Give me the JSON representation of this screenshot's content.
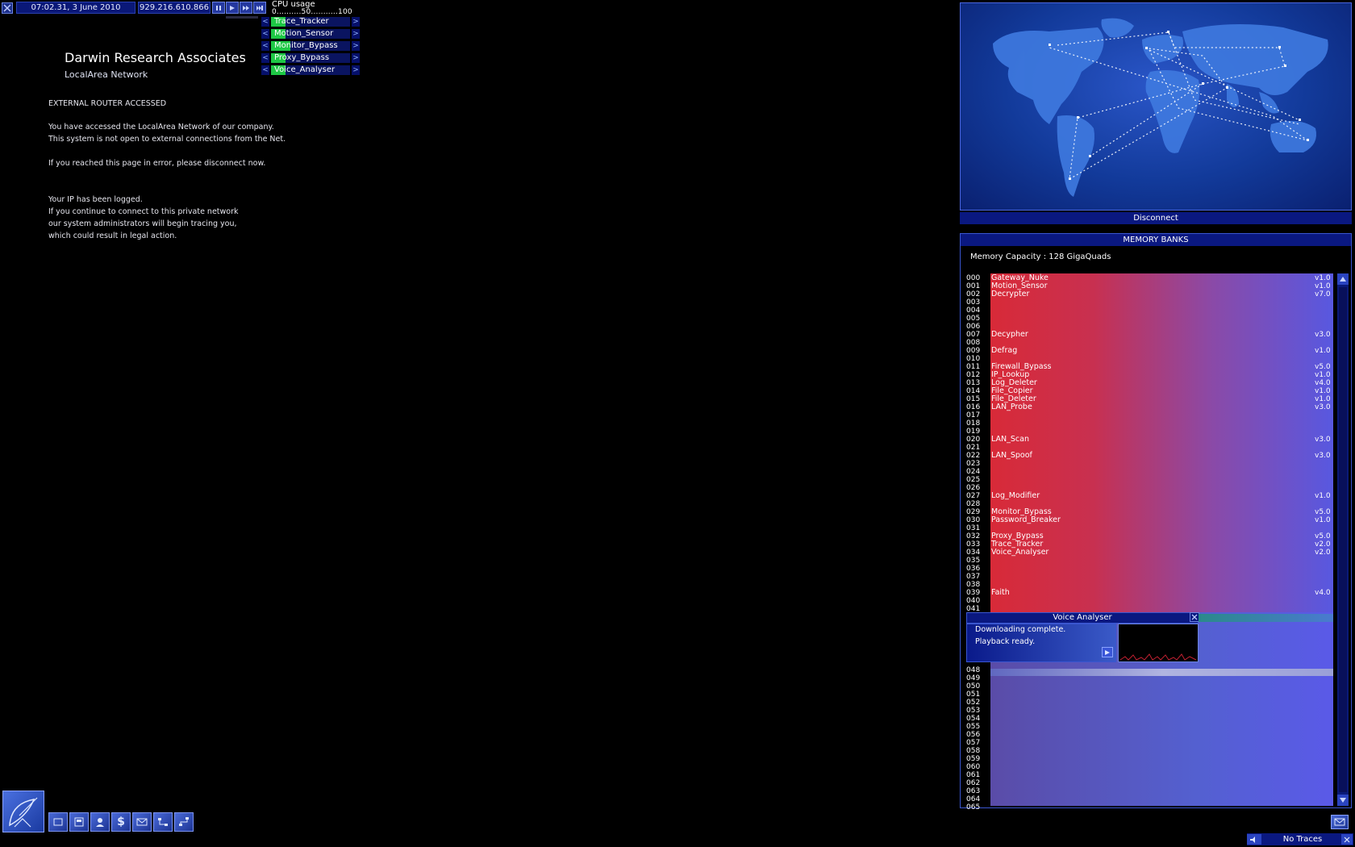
{
  "status": {
    "datetime": "07:02.31, 3 June 2010",
    "ip": "929.216.610.866"
  },
  "cpu": {
    "title": "CPU usage",
    "scale": "0..........50...........100",
    "programs": [
      {
        "name": "Trace_Tracker",
        "usage_fraction": 0.18
      },
      {
        "name": "Motion_Sensor",
        "usage_fraction": 0.18
      },
      {
        "name": "Monitor_Bypass",
        "usage_fraction": 0.24
      },
      {
        "name": "Proxy_Bypass",
        "usage_fraction": 0.18
      },
      {
        "name": "Voice_Analyser",
        "usage_fraction": 0.18
      }
    ],
    "left_arrow": "<",
    "right_arrow": ">"
  },
  "page": {
    "company": "Darwin Research Associates",
    "subtitle": "LocalArea Network",
    "heading": "EXTERNAL ROUTER ACCESSED",
    "lines": [
      "You have accessed the LocalArea Network of our company.",
      "This system is not open to external connections from the Net.",
      "If you reached this page in error, please disconnect now.",
      "Your IP has been logged.",
      "If you continue to connect to this private network",
      "our system administrators will begin tracing you,",
      "which could result in legal action."
    ]
  },
  "map": {
    "disconnect": "Disconnect"
  },
  "memory": {
    "title": "MEMORY BANKS",
    "capacity": "Memory Capacity : 128 GigaQuads",
    "rows_top": [
      "000",
      "001",
      "002",
      "003",
      "004",
      "005",
      "006",
      "007",
      "008",
      "009",
      "010",
      "011",
      "012",
      "013",
      "014",
      "015",
      "016",
      "017",
      "018",
      "019",
      "020",
      "021",
      "022",
      "023",
      "024",
      "025",
      "026",
      "027",
      "028",
      "029",
      "030",
      "031",
      "032",
      "033",
      "034",
      "035",
      "036",
      "037",
      "038",
      "039",
      "040",
      "041"
    ],
    "rows_bottom": [
      "048",
      "049",
      "050",
      "051",
      "052",
      "053",
      "054",
      "055",
      "056",
      "057",
      "058",
      "059",
      "060",
      "061",
      "062",
      "063",
      "064",
      "065"
    ],
    "programs": [
      {
        "slot": 0,
        "name": "Gateway_Nuke",
        "version": "v1.0"
      },
      {
        "slot": 1,
        "name": "Motion_Sensor",
        "version": "v1.0"
      },
      {
        "slot": 2,
        "name": "Decrypter",
        "version": "v7.0"
      },
      {
        "slot": 7,
        "name": "Decypher",
        "version": "v3.0"
      },
      {
        "slot": 9,
        "name": "Defrag",
        "version": "v1.0"
      },
      {
        "slot": 11,
        "name": "Firewall_Bypass",
        "version": "v5.0"
      },
      {
        "slot": 12,
        "name": "IP_Lookup",
        "version": "v1.0"
      },
      {
        "slot": 13,
        "name": "Log_Deleter",
        "version": "v4.0"
      },
      {
        "slot": 14,
        "name": "File_Copier",
        "version": "v1.0"
      },
      {
        "slot": 15,
        "name": "File_Deleter",
        "version": "v1.0"
      },
      {
        "slot": 16,
        "name": "LAN_Probe",
        "version": "v3.0"
      },
      {
        "slot": 20,
        "name": "LAN_Scan",
        "version": "v3.0"
      },
      {
        "slot": 22,
        "name": "LAN_Spoof",
        "version": "v3.0"
      },
      {
        "slot": 27,
        "name": "Log_Modifier",
        "version": "v1.0"
      },
      {
        "slot": 29,
        "name": "Monitor_Bypass",
        "version": "v5.0"
      },
      {
        "slot": 30,
        "name": "Password_Breaker",
        "version": "v1.0"
      },
      {
        "slot": 32,
        "name": "Proxy_Bypass",
        "version": "v5.0"
      },
      {
        "slot": 33,
        "name": "Trace_Tracker",
        "version": "v2.0"
      },
      {
        "slot": 34,
        "name": "Voice_Analyser",
        "version": "v2.0"
      },
      {
        "slot": 39,
        "name": "Faith",
        "version": "v4.0"
      }
    ]
  },
  "voice_analyser": {
    "title": "Voice Analyser",
    "line1": "Downloading complete.",
    "line2": "Playback ready."
  },
  "trace": {
    "status": "No Traces"
  },
  "colors": {
    "accent": "#0a1880",
    "cpu_fill": "#1ec845",
    "memory_start": "#d82a38",
    "memory_end": "#5858e0"
  },
  "icons": {
    "main_menu": "satellite-dish-icon",
    "toolbar": [
      "software-icon",
      "hardware-icon",
      "personal-icon",
      "finance-icon",
      "email-icon",
      "status-icon",
      "network-icon"
    ]
  }
}
